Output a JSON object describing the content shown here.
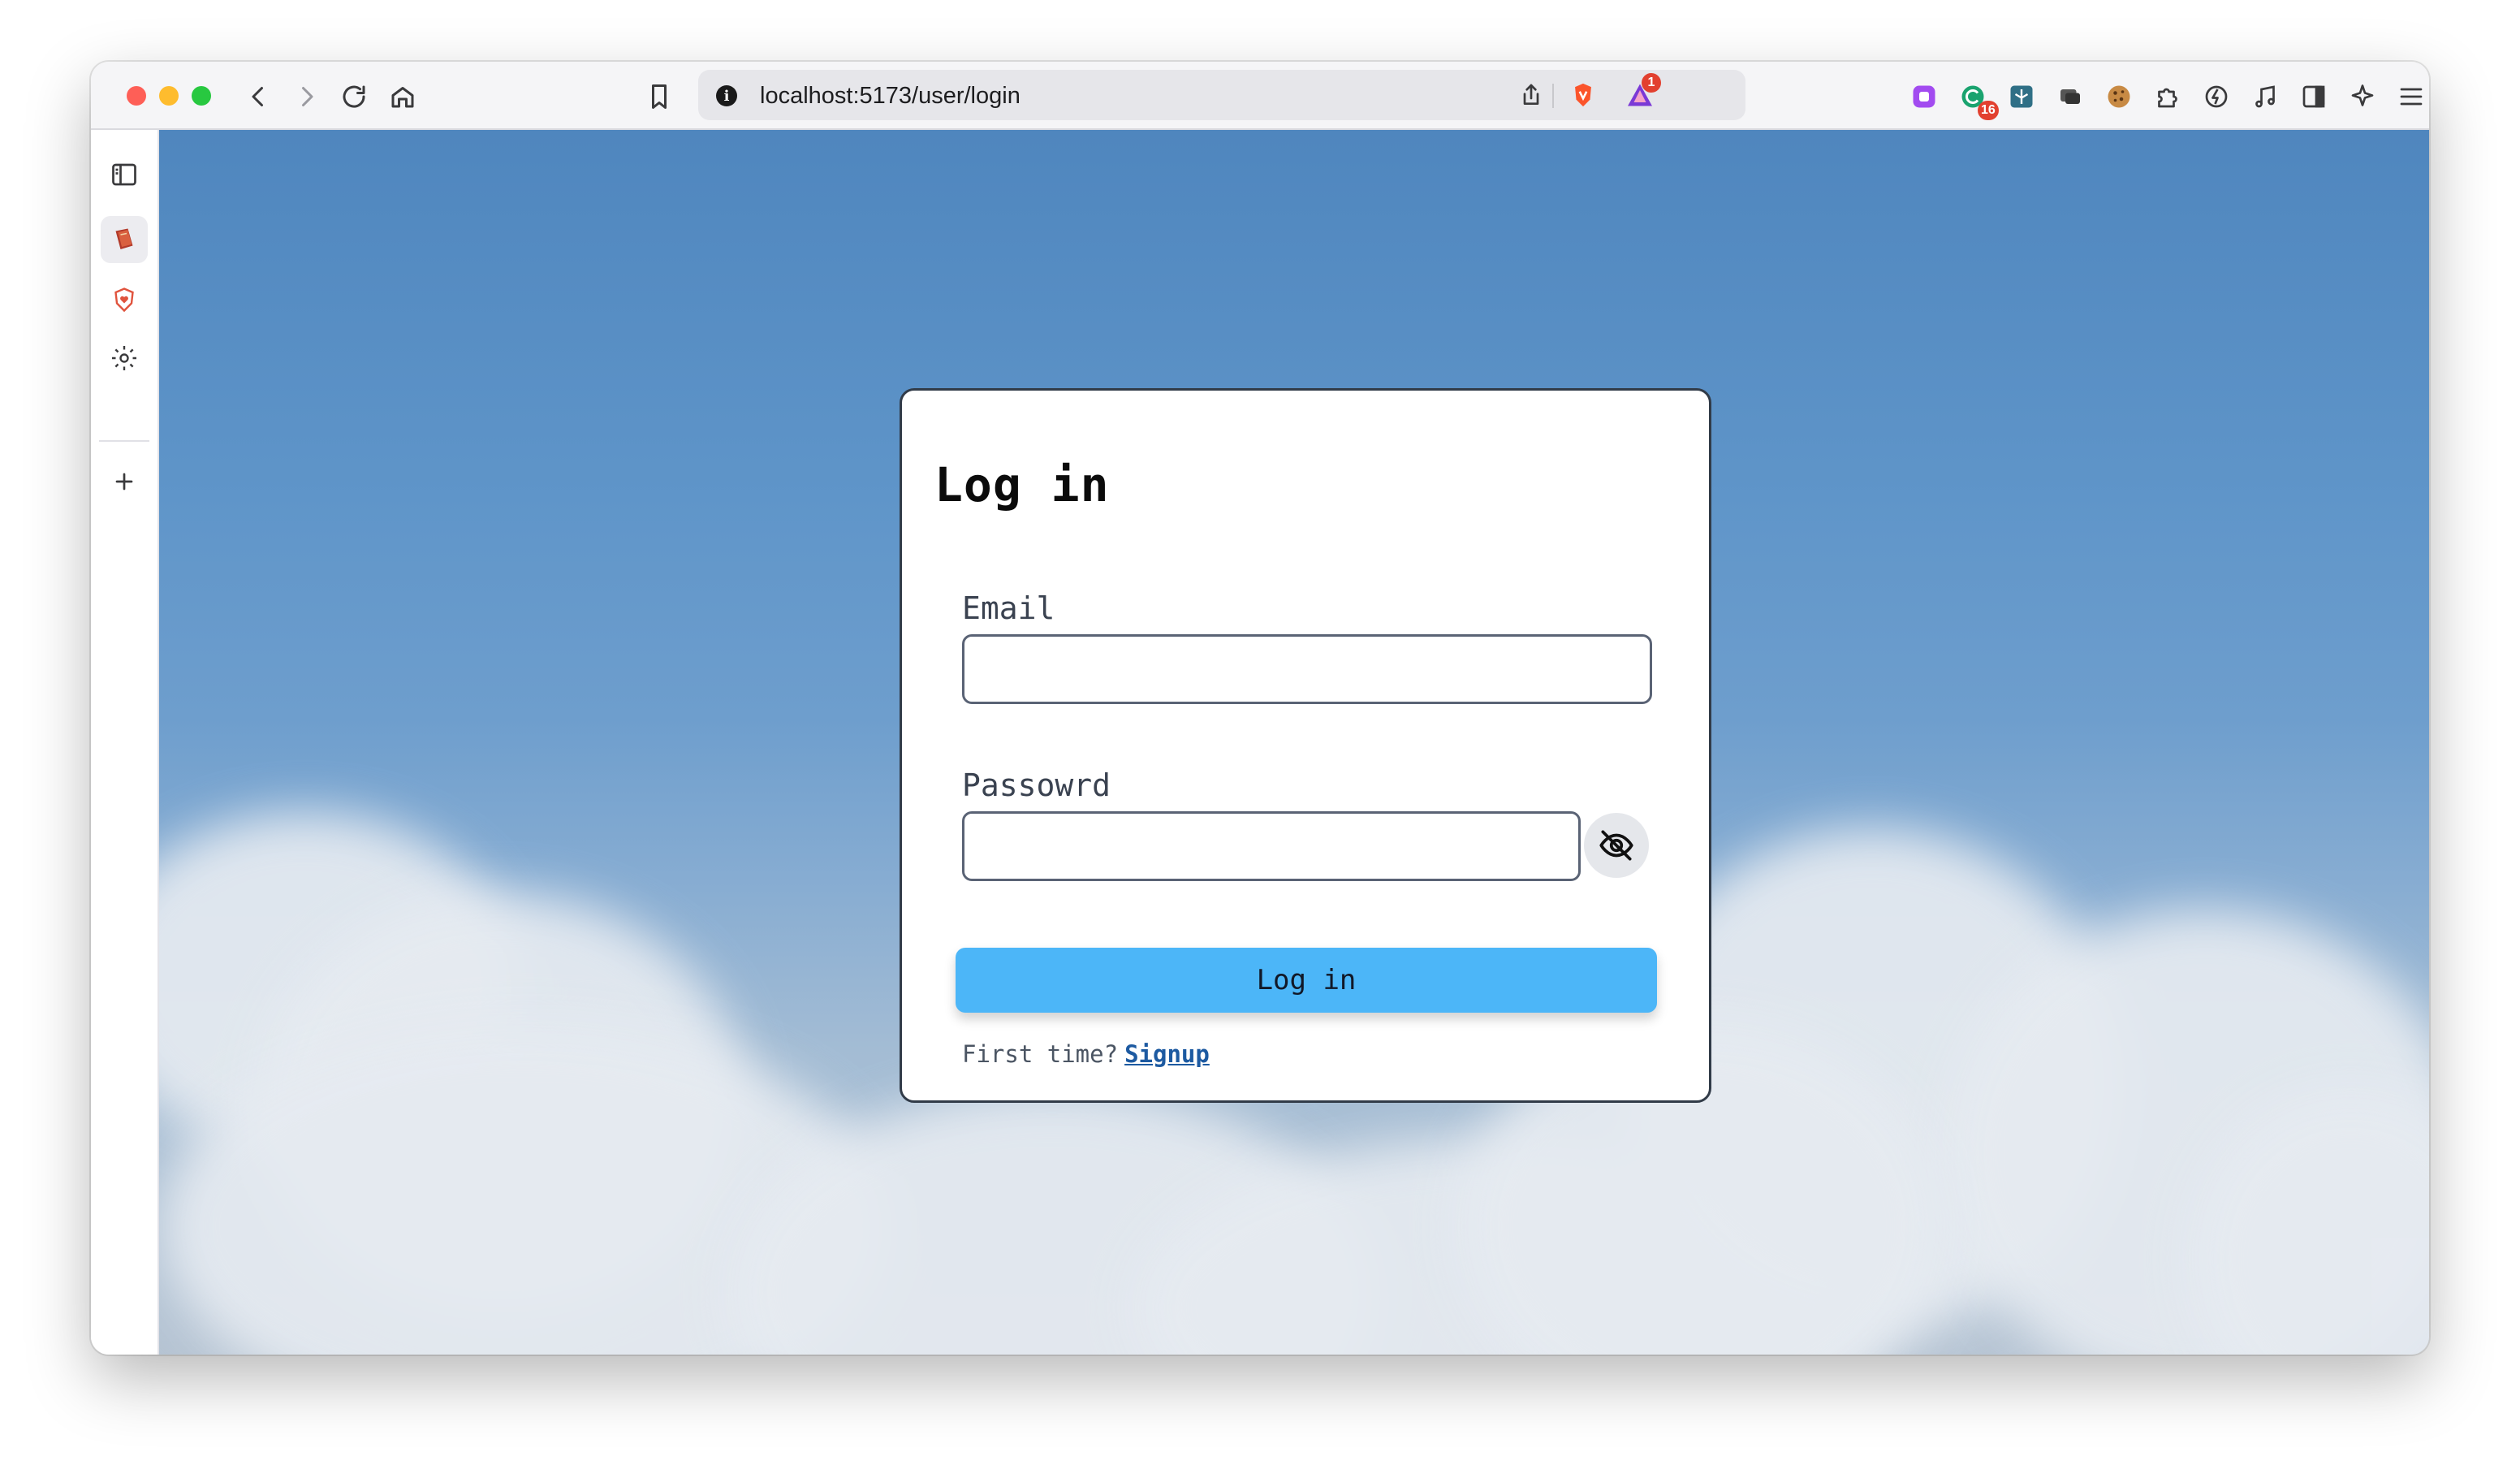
{
  "browser": {
    "url": "localhost:5173/user/login",
    "extension_badge_count": "16",
    "rewards_badge_count": "1"
  },
  "sidebar": {
    "items": [
      {
        "icon": "sidebar-toggle-icon"
      },
      {
        "icon": "book-icon"
      },
      {
        "icon": "shield-heart-icon"
      },
      {
        "icon": "gear-icon"
      },
      {
        "icon": "plus-icon"
      }
    ]
  },
  "login": {
    "title": "Log in",
    "email_label": "Email",
    "email_value": "",
    "password_label": "Passowrd",
    "password_value": "",
    "submit_label": "Log in",
    "footer_text": "First time?",
    "signup_link": "Signup"
  },
  "colors": {
    "button": "#4cb6f8",
    "link": "#1d5aa1",
    "card_border": "#313b48"
  }
}
